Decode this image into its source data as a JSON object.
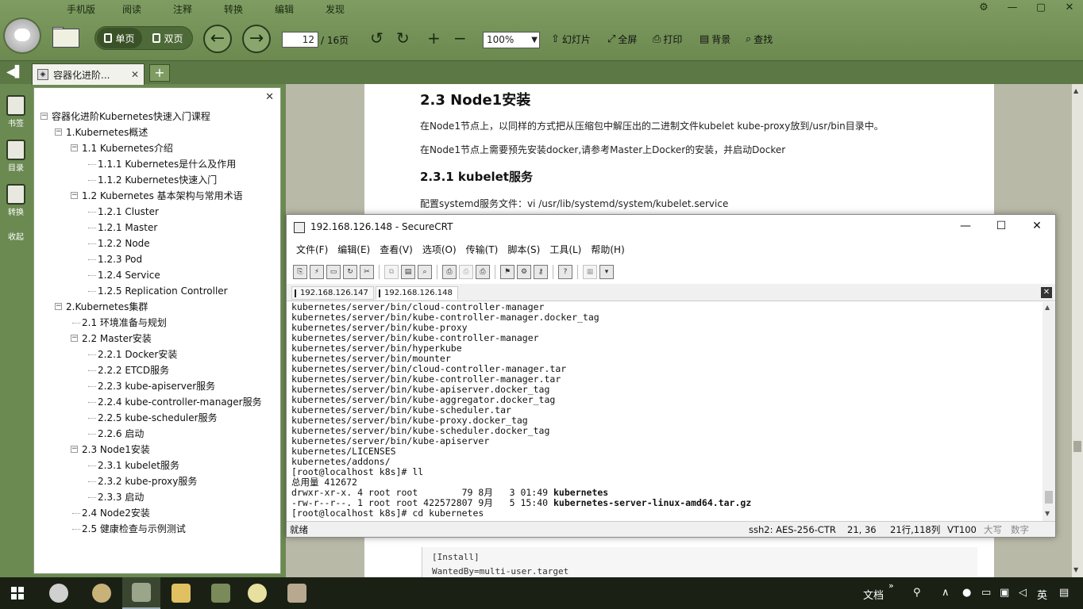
{
  "reader": {
    "menu": [
      "手机版",
      "阅读",
      "注释",
      "转换",
      "编辑",
      "发现"
    ],
    "view_single": "单页",
    "view_double": "双页",
    "page_current": "12",
    "page_total": "/ 16页",
    "zoom": "100%",
    "tools": [
      {
        "icon": "slideshow-icon",
        "label": "幻灯片"
      },
      {
        "icon": "fullscreen-icon",
        "label": "全屏"
      },
      {
        "icon": "print-icon",
        "label": "打印"
      },
      {
        "icon": "background-icon",
        "label": "背景"
      },
      {
        "icon": "search-icon",
        "label": "查找"
      }
    ],
    "tab_title": "容器化进阶...",
    "strip": [
      "书签",
      "目录",
      "转换",
      "收起"
    ]
  },
  "toc": {
    "items": [
      {
        "label": "容器化进阶Kubernetes快速入门课程",
        "level": 0,
        "toggle": "−"
      },
      {
        "label": "1.Kubernetes概述",
        "level": 1,
        "toggle": "−"
      },
      {
        "label": "1.1 Kubernetes介绍",
        "level": 2,
        "toggle": "−"
      },
      {
        "label": "1.1.1 Kubernetes是什么及作用",
        "level": 3,
        "toggle": ""
      },
      {
        "label": "1.1.2 Kubernetes快速入门",
        "level": 3,
        "toggle": ""
      },
      {
        "label": "1.2 Kubernetes 基本架构与常用术语",
        "level": 2,
        "toggle": "−"
      },
      {
        "label": "1.2.1 Cluster",
        "level": 3,
        "toggle": ""
      },
      {
        "label": "1.2.1 Master",
        "level": 3,
        "toggle": ""
      },
      {
        "label": "1.2.2 Node",
        "level": 3,
        "toggle": ""
      },
      {
        "label": "1.2.3 Pod",
        "level": 3,
        "toggle": ""
      },
      {
        "label": "1.2.4 Service",
        "level": 3,
        "toggle": ""
      },
      {
        "label": "1.2.5 Replication Controller",
        "level": 3,
        "toggle": ""
      },
      {
        "label": "2.Kubernetes集群",
        "level": 1,
        "toggle": "−"
      },
      {
        "label": "2.1 环境准备与规划",
        "level": 2,
        "toggle": ""
      },
      {
        "label": "2.2 Master安装",
        "level": 2,
        "toggle": "−"
      },
      {
        "label": "2.2.1 Docker安装",
        "level": 3,
        "toggle": ""
      },
      {
        "label": "2.2.2 ETCD服务",
        "level": 3,
        "toggle": ""
      },
      {
        "label": "2.2.3 kube-apiserver服务",
        "level": 3,
        "toggle": ""
      },
      {
        "label": "2.2.4 kube-controller-manager服务",
        "level": 3,
        "toggle": ""
      },
      {
        "label": "2.2.5 kube-scheduler服务",
        "level": 3,
        "toggle": ""
      },
      {
        "label": "2.2.6 启动",
        "level": 3,
        "toggle": ""
      },
      {
        "label": "2.3 Node1安装",
        "level": 2,
        "toggle": "−"
      },
      {
        "label": "2.3.1 kubelet服务",
        "level": 3,
        "toggle": ""
      },
      {
        "label": "2.3.2 kube-proxy服务",
        "level": 3,
        "toggle": ""
      },
      {
        "label": "2.3.3 启动",
        "level": 3,
        "toggle": ""
      },
      {
        "label": "2.4 Node2安装",
        "level": 2,
        "toggle": ""
      },
      {
        "label": "2.5 健康检查与示例测试",
        "level": 2,
        "toggle": ""
      }
    ]
  },
  "doc": {
    "h2": "2.3 Node1安装",
    "p1": "在Node1节点上，以同样的方式把从压缩包中解压出的二进制文件kubelet kube-proxy放到/usr/bin目录中。",
    "p2": "在Node1节点上需要预先安装docker,请参考Master上Docker的安装，并启动Docker",
    "h3": "2.3.1 kubelet服务",
    "p3": "配置systemd服务文件：vi /usr/lib/systemd/system/kubelet.service",
    "code1": "[Install]",
    "code2": "WantedBy=multi-user.target"
  },
  "crt": {
    "title": "192.168.126.148 - SecureCRT",
    "menu": [
      "文件(F)",
      "编辑(E)",
      "查看(V)",
      "选项(O)",
      "传输(T)",
      "脚本(S)",
      "工具(L)",
      "帮助(H)"
    ],
    "tabs": [
      "192.168.126.147",
      "192.168.126.148"
    ],
    "terminal": [
      {
        "text": "kubernetes/server/bin/cloud-controller-manager"
      },
      {
        "text": "kubernetes/server/bin/kube-controller-manager.docker_tag"
      },
      {
        "text": "kubernetes/server/bin/kube-proxy"
      },
      {
        "text": "kubernetes/server/bin/kube-controller-manager"
      },
      {
        "text": "kubernetes/server/bin/hyperkube"
      },
      {
        "text": "kubernetes/server/bin/mounter"
      },
      {
        "text": "kubernetes/server/bin/cloud-controller-manager.tar"
      },
      {
        "text": "kubernetes/server/bin/kube-controller-manager.tar"
      },
      {
        "text": "kubernetes/server/bin/kube-apiserver.docker_tag"
      },
      {
        "text": "kubernetes/server/bin/kube-aggregator.docker_tag"
      },
      {
        "text": "kubernetes/server/bin/kube-scheduler.tar"
      },
      {
        "text": "kubernetes/server/bin/kube-proxy.docker_tag"
      },
      {
        "text": "kubernetes/server/bin/kube-scheduler.docker_tag"
      },
      {
        "text": "kubernetes/server/bin/kube-apiserver"
      },
      {
        "text": "kubernetes/LICENSES"
      },
      {
        "text": "kubernetes/addons/"
      },
      {
        "text": "[root@localhost k8s]# ll"
      },
      {
        "text": "总用量 412672"
      },
      {
        "text": "drwxr-xr-x. 4 root root        79 8月   3 01:49 ",
        "bold": "kubernetes"
      },
      {
        "text": "-rw-r--r--. 1 root root 422572807 9月   5 15:40 ",
        "bold": "kubernetes-server-linux-amd64.tar.gz"
      },
      {
        "text": "[root@localhost k8s]# cd kubernetes"
      }
    ],
    "status": {
      "ready": "就绪",
      "cipher": "ssh2: AES-256-CTR",
      "cursor": "21,  36",
      "size": "21行,118列",
      "term": "VT100",
      "caps": "大写",
      "num": "数字"
    }
  },
  "taskbar": {
    "tray_text": "文档",
    "ime": "英",
    "tray_more": "»"
  }
}
